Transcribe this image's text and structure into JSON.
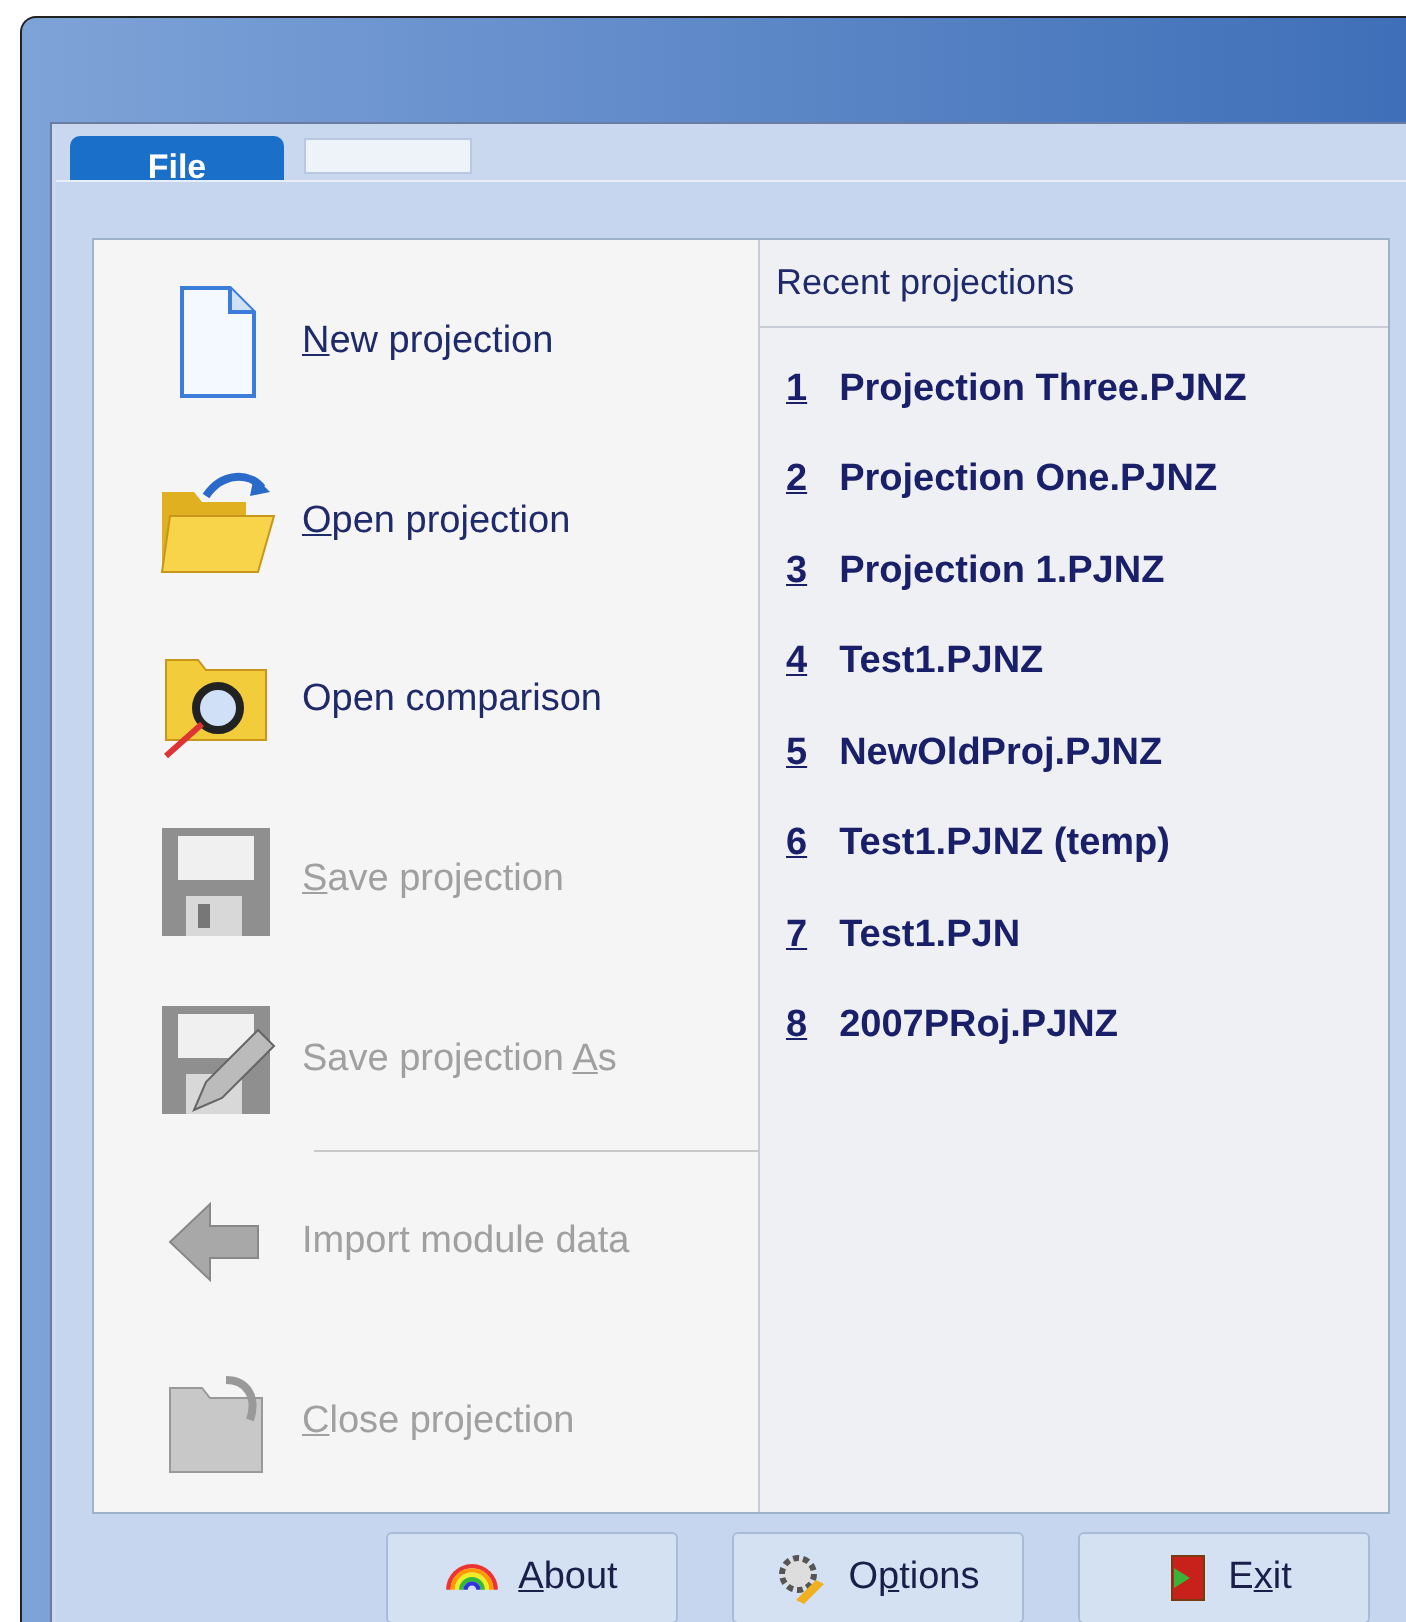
{
  "tabs": [
    {
      "label": "File",
      "selected": true
    }
  ],
  "menu": [
    {
      "kind": "new",
      "access_key": "N",
      "label_after": "ew projection",
      "disabled": false
    },
    {
      "kind": "open",
      "access_key": "O",
      "label_after": "pen projection",
      "disabled": false
    },
    {
      "kind": "compare",
      "label": "Open comparison",
      "disabled": false
    },
    {
      "kind": "save",
      "access_key": "S",
      "label_after": "ave projection",
      "disabled": true
    },
    {
      "kind": "saveas",
      "label_before": "Save projection ",
      "access_key": "A",
      "label_after": "s",
      "disabled": true,
      "separator_after": true
    },
    {
      "kind": "import",
      "label": "Import module data",
      "disabled": true
    },
    {
      "kind": "close",
      "access_key": "C",
      "label_after": "lose projection",
      "disabled": true
    }
  ],
  "recent": {
    "title": "Recent projections",
    "items": [
      {
        "number": "1",
        "name": "Projection Three.PJNZ"
      },
      {
        "number": "2",
        "name": "Projection One.PJNZ"
      },
      {
        "number": "3",
        "name": "Projection 1.PJNZ"
      },
      {
        "number": "4",
        "name": "Test1.PJNZ"
      },
      {
        "number": "5",
        "name": "NewOldProj.PJNZ"
      },
      {
        "number": "6",
        "name": "Test1.PJNZ (temp)"
      },
      {
        "number": "7",
        "name": "Test1.PJN"
      },
      {
        "number": "8",
        "name": "2007PRoj.PJNZ"
      }
    ]
  },
  "buttons": [
    {
      "kind": "about",
      "access_key": "A",
      "label_after": "bout"
    },
    {
      "kind": "options",
      "label_before": "O",
      "access_key": "p",
      "label_after": "tions"
    },
    {
      "kind": "exit",
      "label_before": "E",
      "access_key": "x",
      "label_after": "it"
    }
  ]
}
